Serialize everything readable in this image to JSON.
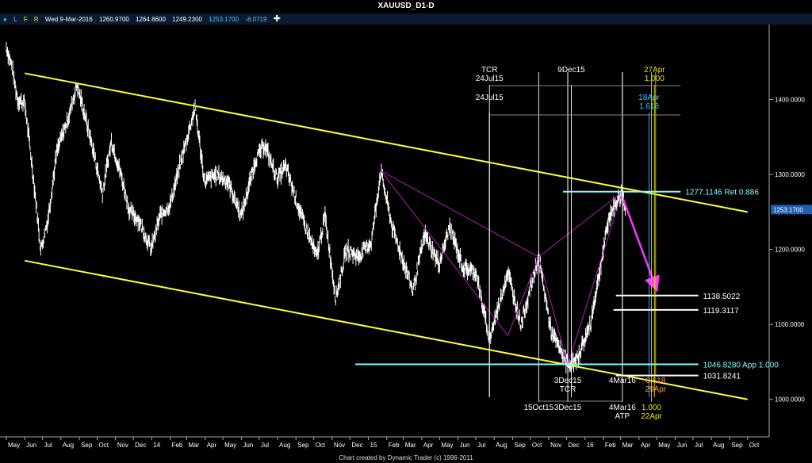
{
  "window": {
    "title": "XAUUSD_D1-D",
    "credit": "Chart created by Dynamic Trader  (c) 1996-2011"
  },
  "infobar": {
    "icons": [
      "circle-icon",
      "l-icon",
      "f-icon",
      "r-icon",
      "plus-icon"
    ],
    "letters": [
      "L",
      "F",
      "R"
    ],
    "date": "Wed 9-Mar-2016",
    "open": "1260.9700",
    "high": "1264.8600",
    "low": "1249.2300",
    "close": "1253.1700",
    "change": "-8.0719",
    "colors": {
      "close": "#4fc3ff",
      "change": "#4fc3ff",
      "text": "#ffffff"
    }
  },
  "chart_data": {
    "type": "candlestick",
    "y_scale": "linear",
    "ylim": [
      950,
      1500
    ],
    "yticks": [
      1000,
      1100,
      1200,
      1300,
      1400
    ],
    "ytick_labels": [
      "1000.0000",
      "1100.0000",
      "1200.0000",
      "1300.0000",
      "1400.0000"
    ],
    "current_price": {
      "label": "1253.1700",
      "value": 1253.17,
      "color": "#1e5fb0"
    },
    "x_tick_labels": [
      "May",
      "Jun",
      "Jul",
      "Aug",
      "Sep",
      "Oct",
      "Nov",
      "Dec",
      "14",
      "Feb",
      "Mar",
      "Apr",
      "May",
      "Jun",
      "Jul",
      "Aug",
      "Sep",
      "Oct",
      "Nov",
      "Dec",
      "15",
      "Feb",
      "Mar",
      "Apr",
      "May",
      "Jun",
      "Jul",
      "Aug",
      "Sep",
      "Oct",
      "Nov",
      "Dec",
      "16",
      "Feb",
      "Mar",
      "Apr",
      "May",
      "Jun",
      "Jul",
      "Aug",
      "Sep",
      "Oct"
    ],
    "x_months": {
      "start": "2013-05",
      "end": "2016-10"
    },
    "price_path": [
      [
        "2013-05-01",
        1470
      ],
      [
        "2013-05-10",
        1445
      ],
      [
        "2013-05-20",
        1400
      ],
      [
        "2013-06-01",
        1395
      ],
      [
        "2013-06-15",
        1300
      ],
      [
        "2013-06-28",
        1200
      ],
      [
        "2013-07-10",
        1240
      ],
      [
        "2013-07-25",
        1330
      ],
      [
        "2013-08-15",
        1380
      ],
      [
        "2013-08-28",
        1420
      ],
      [
        "2013-09-10",
        1380
      ],
      [
        "2013-09-25",
        1330
      ],
      [
        "2013-10-10",
        1275
      ],
      [
        "2013-10-25",
        1345
      ],
      [
        "2013-11-10",
        1300
      ],
      [
        "2013-11-25",
        1250
      ],
      [
        "2013-12-10",
        1240
      ],
      [
        "2013-12-31",
        1200
      ],
      [
        "2014-01-15",
        1245
      ],
      [
        "2014-02-01",
        1260
      ],
      [
        "2014-02-20",
        1320
      ],
      [
        "2014-03-15",
        1390
      ],
      [
        "2014-03-31",
        1290
      ],
      [
        "2014-04-20",
        1300
      ],
      [
        "2014-05-10",
        1290
      ],
      [
        "2014-06-01",
        1245
      ],
      [
        "2014-06-25",
        1320
      ],
      [
        "2014-07-10",
        1340
      ],
      [
        "2014-07-31",
        1295
      ],
      [
        "2014-08-15",
        1310
      ],
      [
        "2014-09-10",
        1245
      ],
      [
        "2014-10-06",
        1190
      ],
      [
        "2014-10-20",
        1245
      ],
      [
        "2014-11-07",
        1135
      ],
      [
        "2014-11-25",
        1200
      ],
      [
        "2014-12-15",
        1190
      ],
      [
        "2015-01-06",
        1210
      ],
      [
        "2015-01-22",
        1305
      ],
      [
        "2015-02-10",
        1230
      ],
      [
        "2015-03-17",
        1145
      ],
      [
        "2015-04-06",
        1220
      ],
      [
        "2015-04-30",
        1180
      ],
      [
        "2015-05-18",
        1230
      ],
      [
        "2015-06-10",
        1175
      ],
      [
        "2015-07-01",
        1170
      ],
      [
        "2015-07-24",
        1080
      ],
      [
        "2015-08-24",
        1170
      ],
      [
        "2015-09-15",
        1100
      ],
      [
        "2015-10-15",
        1190
      ],
      [
        "2015-11-05",
        1090
      ],
      [
        "2015-12-03",
        1046
      ],
      [
        "2015-12-17",
        1050
      ],
      [
        "2016-01-10",
        1100
      ],
      [
        "2016-02-11",
        1245
      ],
      [
        "2016-03-04",
        1277
      ],
      [
        "2016-03-09",
        1253
      ]
    ],
    "channel": {
      "upper": [
        [
          "2013-06-01",
          1435
        ],
        [
          "2016-10-01",
          1250
        ]
      ],
      "lower": [
        [
          "2013-06-01",
          1185
        ],
        [
          "2016-10-01",
          1000
        ]
      ],
      "color": "#ffff33"
    },
    "pattern_lines": [
      [
        [
          "2015-01-22",
          1305
        ],
        [
          "2015-10-15",
          1190
        ]
      ],
      [
        [
          "2015-10-15",
          1190
        ],
        [
          "2016-03-04",
          1277
        ]
      ],
      [
        [
          "2015-01-22",
          1305
        ],
        [
          "2015-08-24",
          1085
        ]
      ],
      [
        [
          "2015-08-24",
          1085
        ],
        [
          "2015-10-15",
          1190
        ]
      ],
      [
        [
          "2015-10-15",
          1190
        ],
        [
          "2015-12-03",
          1046
        ]
      ],
      [
        [
          "2015-12-03",
          1046
        ],
        [
          "2016-03-04",
          1277
        ]
      ]
    ],
    "projection_arrow": [
      [
        "2016-03-04",
        1270
      ],
      [
        "2016-04-30",
        1148
      ]
    ],
    "levels": [
      {
        "price": 1277.1146,
        "label": "1277.1146 Ret 0.886",
        "x_start": "2015-11-25",
        "x_end": "2016-06-10",
        "color": "#7fffff"
      },
      {
        "price": 1138.5022,
        "label": "1138.5022",
        "x_start": "2016-02-22",
        "x_end": "2016-07-10",
        "color": "#ffffff"
      },
      {
        "price": 1119.3117,
        "label": "1119.3117",
        "x_start": "2016-02-18",
        "x_end": "2016-07-10",
        "color": "#ffffff"
      },
      {
        "price": 1046.828,
        "label": "1046.8280 App 1.000",
        "x_start": "2014-12-10",
        "x_end": "2016-07-10",
        "color": "#7fffff"
      },
      {
        "price": 1031.8241,
        "label": "1031.8241",
        "x_start": "2016-02-22",
        "x_end": "2016-07-10",
        "color": "#ffffff"
      }
    ],
    "time_markers": [
      {
        "date": "2015-07-24",
        "labels": [
          "TCR",
          "24Jul15"
        ],
        "position": "top",
        "color": "#ffffff"
      },
      {
        "date": "2015-07-24",
        "labels": [
          "24Jul15"
        ],
        "position": "upper",
        "color": "#ffffff"
      },
      {
        "date": "2015-12-09",
        "labels": [
          "9Dec15"
        ],
        "position": "top",
        "color": "#ffffff"
      },
      {
        "date": "2016-04-27",
        "labels": [
          "27Apr",
          "1.000"
        ],
        "position": "top",
        "color": "#e6e600"
      },
      {
        "date": "2016-04-18",
        "labels": [
          "18Apr",
          "1.618"
        ],
        "position": "upper",
        "color": "#33ccff"
      },
      {
        "date": "2015-12-03",
        "labels": [
          "3Dec15",
          "TCR"
        ],
        "position": "bottom",
        "color": "#ffffff"
      },
      {
        "date": "2015-10-15",
        "labels": [
          "15Oct15"
        ],
        "position": "lower",
        "color": "#ffffff"
      },
      {
        "date": "2015-12-03",
        "labels": [
          "3Dec15"
        ],
        "position": "lower",
        "color": "#ffffff"
      },
      {
        "date": "2016-03-04",
        "labels": [
          "4Mar16"
        ],
        "position": "bottom",
        "color": "#ffffff"
      },
      {
        "date": "2016-03-04",
        "labels": [
          "4Mar16",
          "ATP"
        ],
        "position": "lower",
        "color": "#ffffff"
      },
      {
        "date": "2016-04-29",
        "labels": [
          "0.618",
          "29Apr"
        ],
        "position": "bottom",
        "color": "#ff9966"
      },
      {
        "date": "2016-04-22",
        "labels": [
          "1.000",
          "22Apr"
        ],
        "position": "lower",
        "color": "#e6e600"
      }
    ]
  }
}
